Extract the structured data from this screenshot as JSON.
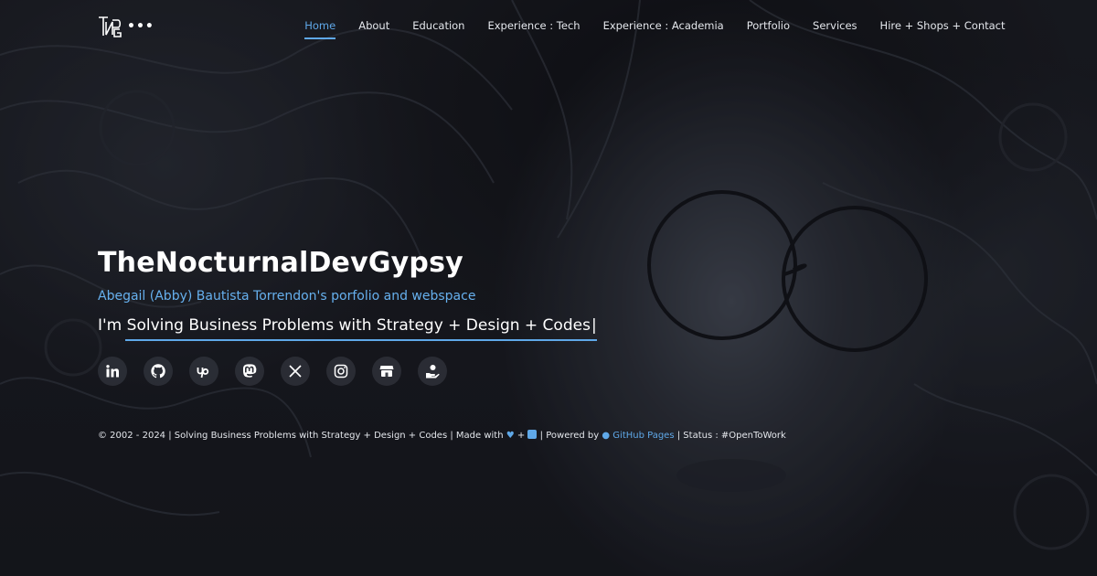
{
  "header": {
    "logo_text": "TNDG",
    "logo_more": "•••",
    "nav": [
      {
        "label": "Home",
        "active": true
      },
      {
        "label": "About"
      },
      {
        "label": "Education"
      },
      {
        "label": "Experience : Tech"
      },
      {
        "label": "Experience : Academia"
      },
      {
        "label": "Portfolio"
      },
      {
        "label": "Services"
      },
      {
        "label": "Hire + Shops + Contact"
      }
    ]
  },
  "hero": {
    "title": "TheNocturnalDevGypsy",
    "subtitle": "Abegail (Abby) Bautista Torrendon's porfolio and webspace",
    "typed_text": "I'm Solving Business Problems with Strategy + Design + Codes",
    "cursor": "|"
  },
  "socials": [
    {
      "icon": "linkedin-icon"
    },
    {
      "icon": "github-icon"
    },
    {
      "icon": "upwork-icon"
    },
    {
      "icon": "mastodon-icon"
    },
    {
      "icon": "x-twitter-icon"
    },
    {
      "icon": "instagram-icon"
    },
    {
      "icon": "shop-icon"
    },
    {
      "icon": "hire-hand-icon"
    }
  ],
  "footer": {
    "copyright": "© 2002 - 2024 | Solving Business Problems with Strategy + Design + Codes | Made with",
    "plus": "+",
    "powered": "| Powered by",
    "github_pages": "GitHub Pages",
    "status": "| Status : #OpenToWork"
  },
  "colors": {
    "accent": "#5fa8e8",
    "background": "#14161c",
    "text": "#ffffff"
  }
}
